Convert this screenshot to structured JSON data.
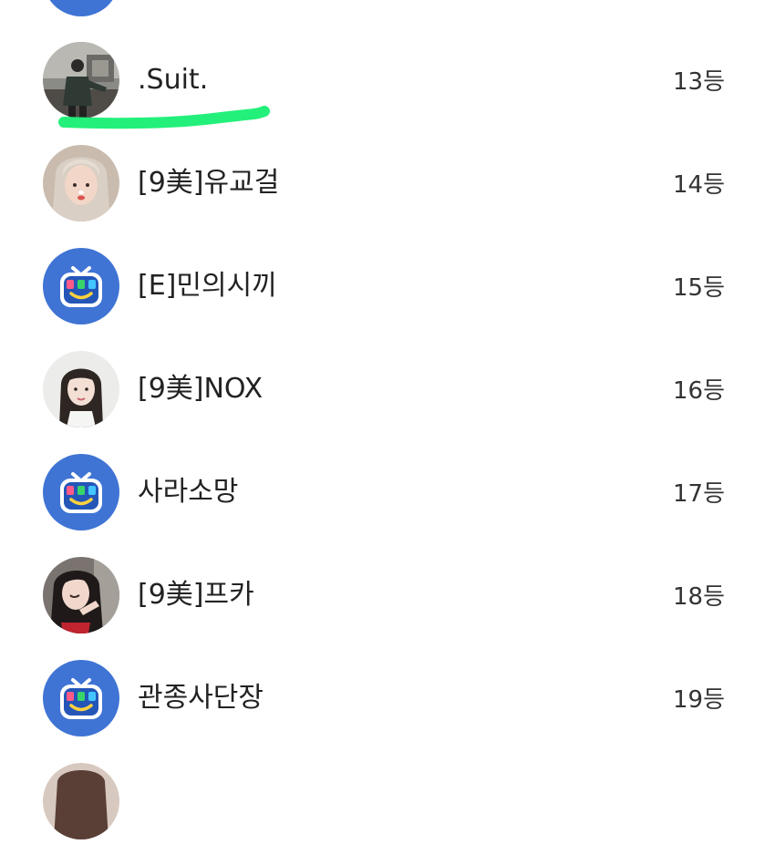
{
  "ranking": {
    "items": [
      {
        "name": "",
        "rank": "",
        "avatar": "tv-default-avatar-icon"
      },
      {
        "name": ".Suit.",
        "rank": "13등",
        "avatar": "user-photo-avatar"
      },
      {
        "name": "[9美]유교걸",
        "rank": "14등",
        "avatar": "user-photo-avatar"
      },
      {
        "name": "[E]민의시끼",
        "rank": "15등",
        "avatar": "tv-default-avatar-icon"
      },
      {
        "name": "[9美]NOX",
        "rank": "16등",
        "avatar": "user-photo-avatar"
      },
      {
        "name": "사라소망",
        "rank": "17등",
        "avatar": "tv-default-avatar-icon"
      },
      {
        "name": "[9美]프카",
        "rank": "18등",
        "avatar": "user-photo-avatar"
      },
      {
        "name": "관종사단장",
        "rank": "19등",
        "avatar": "tv-default-avatar-icon"
      },
      {
        "name": "",
        "rank": "",
        "avatar": "user-photo-avatar"
      }
    ]
  },
  "colors": {
    "default_avatar_bg": "#3f74d4",
    "highlight_marker": "#22f07a",
    "text": "#222222"
  }
}
